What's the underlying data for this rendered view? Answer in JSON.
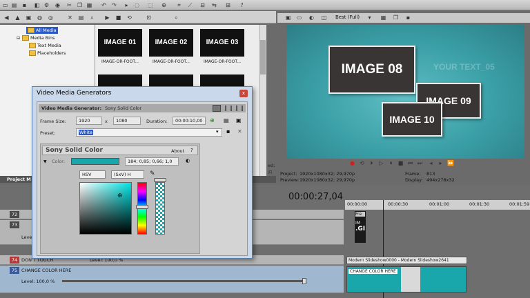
{
  "explorer": {
    "tree": [
      "All Media",
      "Media Bins",
      "Text Media",
      "Placeholders"
    ],
    "thumbs": [
      "IMAGE 01",
      "IMAGE 02",
      "IMAGE 03"
    ],
    "thumb_captions": [
      "IMAGE-OR-FOOT...",
      "IMAGE-OR-FOOT...",
      "IMAGE-OR-FOOT..."
    ],
    "project_tab": "Project M"
  },
  "preview": {
    "quality": "Best (Full)",
    "cards": [
      "IMAGE 08",
      "IMAGE 09",
      "IMAGE 10"
    ],
    "overlay_text": "YOUR TEXT_05",
    "project_label": "Project:",
    "project_value": "1920x1080x32; 29,970p",
    "preview_label": "Preview:",
    "preview_value": "1920x1080x32; 29,970p",
    "frame_label": "Frame:",
    "frame_value": "813",
    "display_label": "Display:",
    "display_value": "494x278x32",
    "side_text_1": "ed;",
    "side_text_2": "Fi"
  },
  "timeline": {
    "timecode": "00:00:27,04",
    "ruler": [
      "00:00:00",
      "00:00:30",
      "00:01:00",
      "00:01:30",
      "00:01:59"
    ],
    "tracks": [
      {
        "num": "72",
        "name": "",
        "color": "#4a4a4a"
      },
      {
        "num": "73",
        "name": "",
        "color": "#4a4a4a"
      },
      {
        "num": "74",
        "name": "DON'T TOUCH",
        "color": "#b23a3a"
      },
      {
        "num": "75",
        "name": "CHANGE COLOR HERE",
        "color": "#3a5a9a"
      }
    ],
    "level_label": "Level:",
    "level_value_74": "Level: 100,0 %",
    "level_value_75": "Level: 100,0 %",
    "clip_slideshow": "Modern Slideshow0000 - Modern Slideshow2641",
    "clip_color": "CHANGE COLOR HERE",
    "clip_small_1": "Fre",
    "clip_small_2": "IM",
    "clip_small_3": ".GI"
  },
  "dialog": {
    "title": "Video Media Generators",
    "close": "x",
    "generator_label": "Video Media Generator:",
    "generator_value": "Sony Solid Color",
    "frame_size_label": "Frame Size:",
    "width": "1920",
    "x": "x",
    "height": "1080",
    "duration_label": "Duration:",
    "duration": "00:00:10,00",
    "preset_label": "Preset:",
    "preset_value": "White",
    "plugin_name": "Sony Solid Color",
    "about": "About",
    "help": "?",
    "color_label": "Color:",
    "color_value": "184; 0,85; 0,66; 1,0",
    "color_mode": "HSV",
    "channel": "(SxV) H",
    "swatch_color": "#1aa7ab"
  }
}
